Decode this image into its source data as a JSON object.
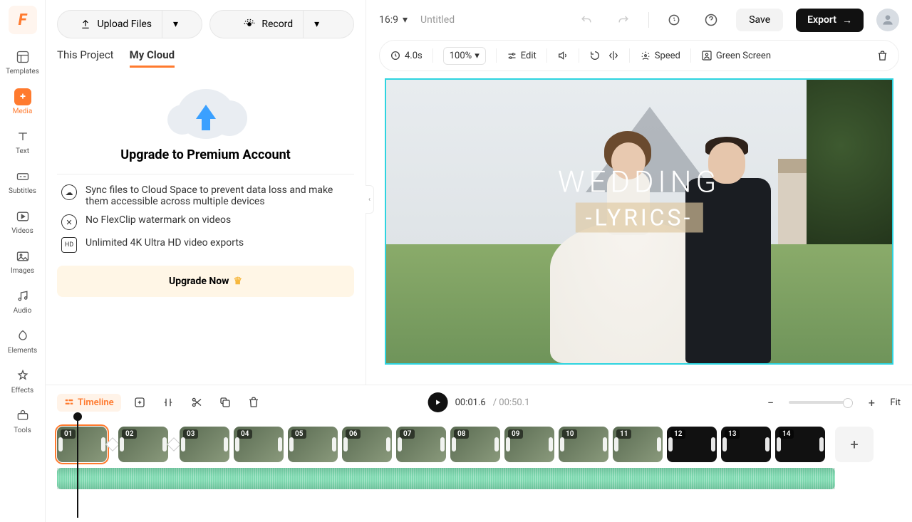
{
  "leftbar": {
    "items": [
      {
        "label": "Templates"
      },
      {
        "label": "Media"
      },
      {
        "label": "Text"
      },
      {
        "label": "Subtitles"
      },
      {
        "label": "Videos"
      },
      {
        "label": "Images"
      },
      {
        "label": "Audio"
      },
      {
        "label": "Elements"
      },
      {
        "label": "Effects"
      },
      {
        "label": "Tools"
      }
    ]
  },
  "panel": {
    "upload_label": "Upload Files",
    "record_label": "Record",
    "tabs": {
      "project": "This Project",
      "cloud": "My Cloud"
    },
    "upgrade_title": "Upgrade to Premium Account",
    "features": [
      "Sync files to Cloud Space to prevent data loss and make them accessible across multiple devices",
      "No FlexClip watermark on videos",
      "Unlimited 4K Ultra HD video exports"
    ],
    "upgrade_btn": "Upgrade Now"
  },
  "header": {
    "ratio": "16:9",
    "title": "Untitled",
    "save": "Save",
    "export": "Export"
  },
  "toolbar": {
    "duration": "4.0s",
    "zoom": "100%",
    "edit": "Edit",
    "speed": "Speed",
    "green": "Green Screen"
  },
  "canvas": {
    "line1": "WEDDING",
    "line2": "-LYRICS-"
  },
  "timeline": {
    "chip": "Timeline",
    "current": "00:01.6",
    "total": "/ 00:50.1",
    "fit": "Fit",
    "clips": [
      "01",
      "02",
      "03",
      "04",
      "05",
      "06",
      "07",
      "08",
      "09",
      "10",
      "11",
      "12",
      "13",
      "14"
    ]
  }
}
